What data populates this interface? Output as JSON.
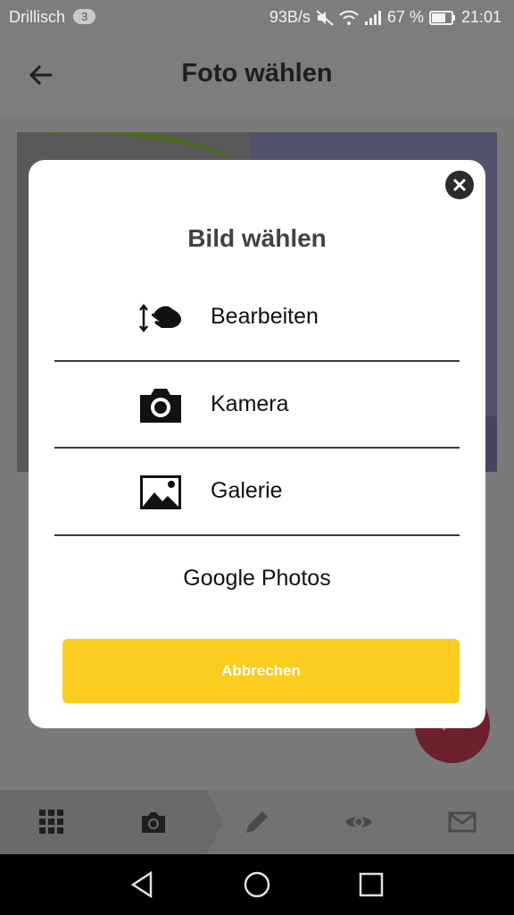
{
  "status_bar": {
    "carrier": "Drillisch",
    "notification_count": "3",
    "network_speed": "93B/s",
    "battery": "67 %",
    "time": "21:01"
  },
  "app_bar": {
    "title": "Foto wählen",
    "back_icon": "arrow-left-icon"
  },
  "dialog": {
    "title": "Bild wählen",
    "options": [
      {
        "label": "Bearbeiten",
        "icon": "hand-swipe-icon"
      },
      {
        "label": "Kamera",
        "icon": "camera-icon"
      },
      {
        "label": "Galerie",
        "icon": "image-icon"
      },
      {
        "label": "Google Photos",
        "icon": ""
      }
    ],
    "cancel_label": "Abbrechen",
    "accent_color": "#FCCC1F"
  },
  "bottom_nav": {
    "items": [
      "grid-icon",
      "camera-icon",
      "pencil-icon",
      "eye-icon",
      "mail-icon"
    ],
    "active_index": 1
  },
  "colors": {
    "overlay": "#7a7a7a",
    "fab": "#6d1f2c"
  }
}
